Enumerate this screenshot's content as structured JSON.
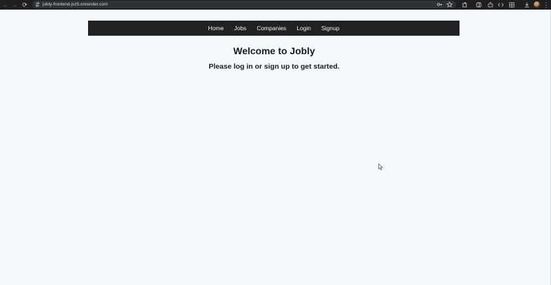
{
  "browser": {
    "url": "jobly-frontend-jvz5.onrender.com"
  },
  "nav": {
    "links": [
      "Home",
      "Jobs",
      "Companies",
      "Login",
      "Signup"
    ]
  },
  "main": {
    "title": "Welcome to Jobly",
    "subtitle": "Please log in or sign up to get started."
  },
  "colors": {
    "nav_background": "#212121",
    "page_background": "#f7f8fb",
    "browser_bar": "#1f1f1f"
  }
}
